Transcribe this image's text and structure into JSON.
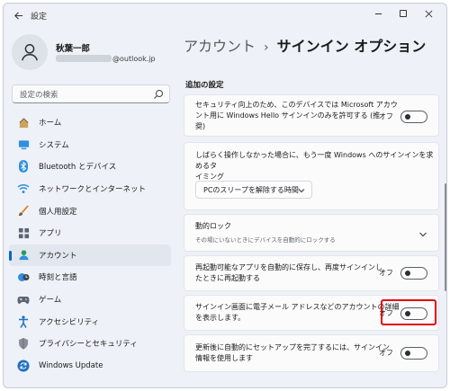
{
  "window": {
    "title": "設定"
  },
  "profile": {
    "name": "秋葉一郎",
    "email_suffix": "@outlook.jp"
  },
  "search": {
    "placeholder": "設定の検索"
  },
  "nav": {
    "items": [
      {
        "label": "ホーム",
        "icon": "home-icon"
      },
      {
        "label": "システム",
        "icon": "system-icon"
      },
      {
        "label": "Bluetooth とデバイス",
        "icon": "bluetooth-icon"
      },
      {
        "label": "ネットワークとインターネット",
        "icon": "network-icon"
      },
      {
        "label": "個人用設定",
        "icon": "brush-icon"
      },
      {
        "label": "アプリ",
        "icon": "apps-icon"
      },
      {
        "label": "アカウント",
        "icon": "account-icon",
        "active": true
      },
      {
        "label": "時刻と言語",
        "icon": "time-language-icon"
      },
      {
        "label": "ゲーム",
        "icon": "gaming-icon"
      },
      {
        "label": "アクセシビリティ",
        "icon": "accessibility-icon"
      },
      {
        "label": "プライバシーとセキュリティ",
        "icon": "shield-icon"
      },
      {
        "label": "Windows Update",
        "icon": "update-icon"
      }
    ]
  },
  "breadcrumb": {
    "parent": "アカウント",
    "separator": "›",
    "current": "サインイン オプション"
  },
  "section": {
    "label": "追加の設定"
  },
  "settings": {
    "hello_only": {
      "line1": "セキュリティ向上のため、このデバイスでは Microsoft アカウ",
      "line2": "ント用に Windows Hello サインインのみを許可する (推",
      "line3": "奨)",
      "state": "オフ"
    },
    "require_signin": {
      "line1": "しばらく操作しなかった場合に、もう一度 Windows へのサインインを求めるタ",
      "line2": "イミング",
      "dropdown": "PCのスリープを解除する時間"
    },
    "dynamic_lock": {
      "title": "動的ロック",
      "subtitle": "その場にいないときにデバイスを自動的にロックする"
    },
    "restart_apps": {
      "line1": "再起動可能なアプリを自動的に保存し、再度サインインし",
      "line2": "たときに再起動する",
      "state": "オフ"
    },
    "show_email": {
      "line1": "サインイン画面に電子メール アドレスなどのアカウントの詳細",
      "line2": "を表示します。",
      "state": "オフ"
    },
    "auto_setup": {
      "line1": "更新後に自動的にセットアップを完了するには、サインイン",
      "line2": "情報を使用します",
      "state": "オフ"
    }
  },
  "colors": {
    "accent": "#0067c0",
    "highlight": "#e60012",
    "background": "#eef1f7"
  }
}
